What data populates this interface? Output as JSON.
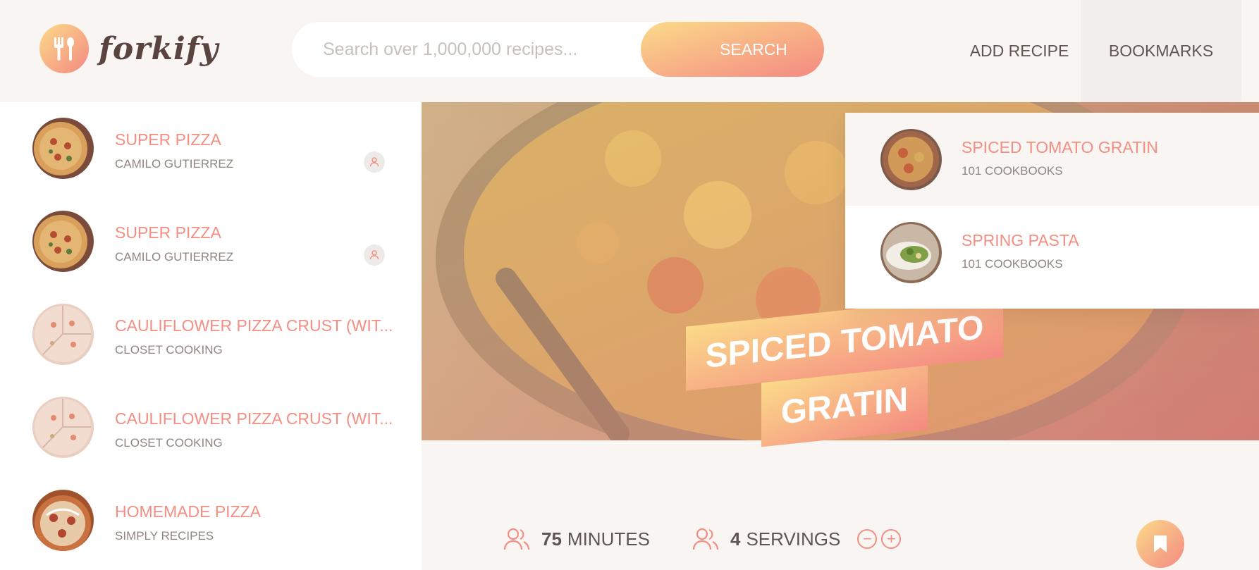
{
  "header": {
    "logo_text": "forkify",
    "logo_icon": "fork-spoon-icon",
    "search_placeholder": "Search over 1,000,000 recipes...",
    "search_button": "SEARCH",
    "add_recipe": "ADD RECIPE",
    "bookmarks": "BOOKMARKS"
  },
  "results": [
    {
      "title": "SUPER PIZZA",
      "publisher": "CAMILO GUTIERREZ",
      "user_generated": true,
      "image": "pizza"
    },
    {
      "title": "SUPER PIZZA",
      "publisher": "CAMILO GUTIERREZ",
      "user_generated": true,
      "image": "pizza"
    },
    {
      "title": "CAULIFLOWER PIZZA CRUST (WIT...",
      "publisher": "CLOSET COOKING",
      "user_generated": false,
      "image": "cauliflower-pizza"
    },
    {
      "title": "CAULIFLOWER PIZZA CRUST (WIT...",
      "publisher": "CLOSET COOKING",
      "user_generated": false,
      "image": "cauliflower-pizza"
    },
    {
      "title": "HOMEMADE PIZZA",
      "publisher": "SIMPLY RECIPES",
      "user_generated": false,
      "image": "homemade-pizza"
    }
  ],
  "recipe": {
    "title_line1": "SPICED TOMATO",
    "title_line2": "GRATIN",
    "minutes_value": "75",
    "minutes_unit": "MINUTES",
    "servings_value": "4",
    "servings_unit": "SERVINGS"
  },
  "bookmarks": [
    {
      "title": "SPICED TOMATO GRATIN",
      "publisher": "101 COOKBOOKS",
      "active": true,
      "image": "gratin"
    },
    {
      "title": "SPRING PASTA",
      "publisher": "101 COOKBOOKS",
      "active": false,
      "image": "pasta"
    }
  ],
  "colors": {
    "accent": "#f38e82",
    "gradient_start": "#fbdb89",
    "gradient_end": "#f48982",
    "background": "#f9f5f3",
    "text": "#615551"
  }
}
